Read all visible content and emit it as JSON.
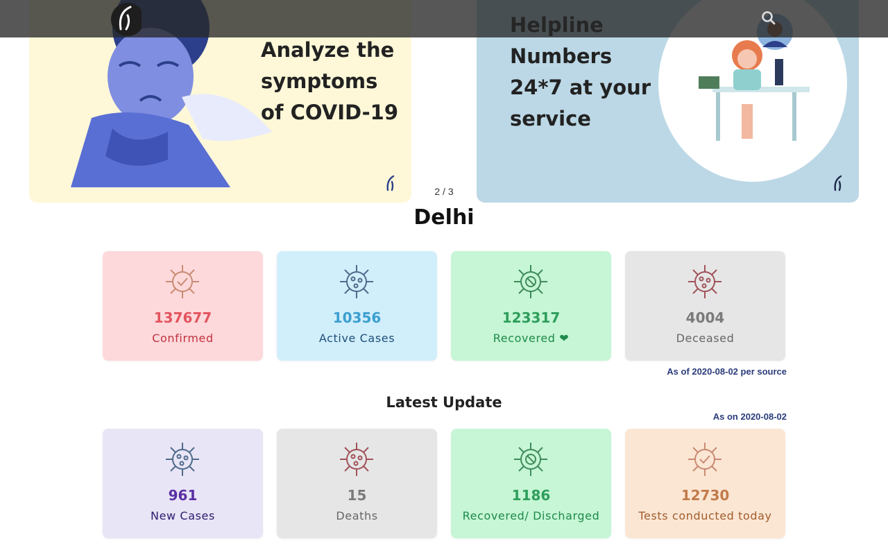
{
  "carousel": {
    "slides": [
      {
        "text": "Analyze the symptoms of COVID-19"
      },
      {
        "text": "Helpline Numbers 24*7 at your service"
      }
    ],
    "pager": "2 / 3"
  },
  "city": "Delhi",
  "summary": {
    "cards": [
      {
        "value": "137677",
        "label": "Confirmed"
      },
      {
        "value": "10356",
        "label": "Active Cases"
      },
      {
        "value": "123317",
        "label": "Recovered ❤"
      },
      {
        "value": "4004",
        "label": "Deceased"
      }
    ],
    "as_of": "As of 2020-08-02 per source"
  },
  "latest": {
    "title": "Latest Update",
    "as_on": "As on 2020-08-02",
    "cards": [
      {
        "value": "961",
        "label": "New Cases"
      },
      {
        "value": "15",
        "label": "Deaths"
      },
      {
        "value": "1186",
        "label": "Recovered/ Discharged"
      },
      {
        "value": "12730",
        "label": "Tests conducted today"
      }
    ]
  },
  "colors": {
    "confirmed_bg": "#fdd9db",
    "confirmed_num": "#e3545f",
    "confirmed_lbl": "#c2313f",
    "active_bg": "#d1eefb",
    "active_num": "#3a9fcf",
    "active_lbl": "#1f4f78",
    "recovered_bg": "#c6f6d5",
    "recovered_num": "#2e9e5b",
    "recovered_lbl": "#1e8a4a",
    "deceased_bg": "#e6e6e6",
    "deceased_num": "#7a7a7a",
    "deceased_lbl": "#666666",
    "new_bg": "#e8e5f6",
    "new_num": "#5a2fa3",
    "new_lbl": "#2d1a6e",
    "tests_bg": "#fbe6d4",
    "tests_num": "#c27b4a",
    "tests_lbl": "#a05d2c"
  },
  "icons": [
    "logo-icon",
    "search-icon",
    "virus-icon"
  ]
}
